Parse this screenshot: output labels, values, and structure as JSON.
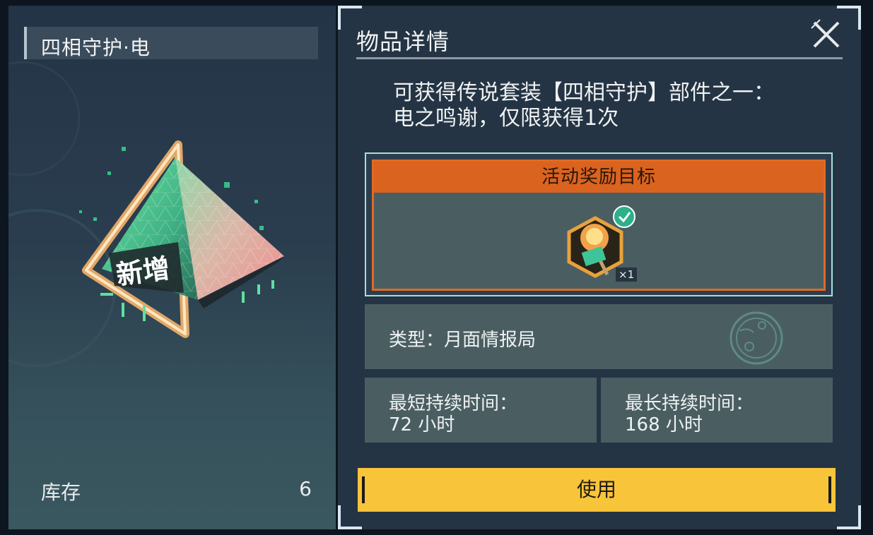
{
  "item": {
    "title": "四相守护·电",
    "badge_text": "新增",
    "stock_label": "库存",
    "stock_value": "6"
  },
  "detail": {
    "panel_title": "物品详情",
    "description": "可获得传说套装【四相守护】部件之一：电之鸣谢，仅限获得1次",
    "reward": {
      "header": "活动奖励目标",
      "quantity": "×1"
    },
    "type_text": "类型：月面情报局",
    "min_duration_label": "最短持续时间：",
    "min_duration_value": "72 小时",
    "max_duration_label": "最长持续时间：",
    "max_duration_value": "168 小时",
    "use_button": "使用"
  },
  "colors": {
    "accent_yellow": "#f8c43a",
    "reward_orange": "#d9631f",
    "panel_bg": "#243444"
  }
}
